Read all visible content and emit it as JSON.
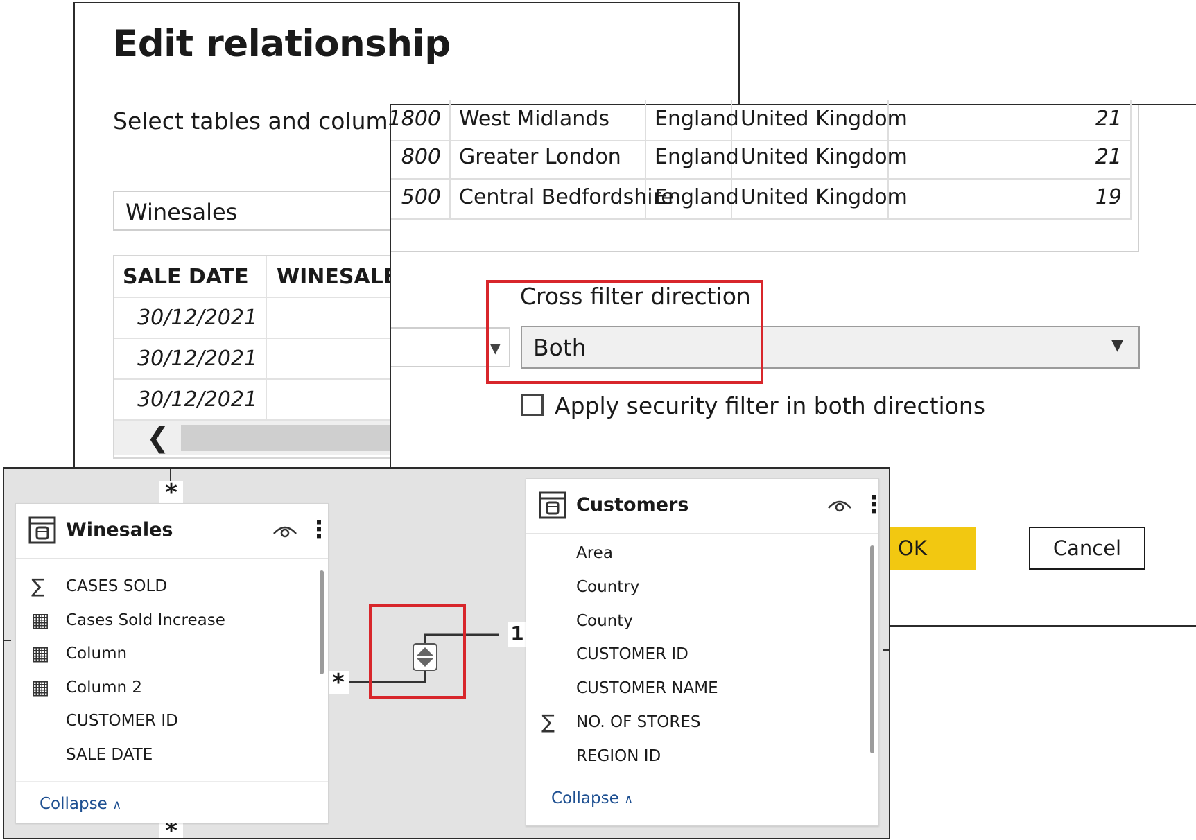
{
  "back_dialog": {
    "title": "Edit relationship",
    "subtitle": "Select tables and column",
    "table_select": {
      "value": "Winesales"
    },
    "preview": {
      "columns": [
        "SALE DATE",
        "WINESALES"
      ],
      "rows": [
        [
          "30/12/2021"
        ],
        [
          "30/12/2021"
        ],
        [
          "30/12/2021"
        ]
      ]
    }
  },
  "front_dialog": {
    "preview_rows": [
      [
        "1800",
        "West Midlands",
        "England",
        "United Kingdom",
        "21"
      ],
      [
        "800",
        "Greater London",
        "England",
        "United Kingdom",
        "21"
      ],
      [
        "500",
        "Central Bedfordshire",
        "England",
        "United Kingdom",
        "19"
      ]
    ],
    "cross_filter": {
      "label": "Cross filter direction",
      "value": "Both"
    },
    "security_filter": {
      "label": "Apply security filter in both directions",
      "checked": false
    },
    "ok_label": "OK",
    "cancel_label": "Cancel"
  },
  "model_view": {
    "winesales": {
      "title": "Winesales",
      "fields": [
        {
          "name": "CASES SOLD",
          "icon": "sigma-icon"
        },
        {
          "name": "Cases Sold Increase",
          "icon": "calculated-column-icon"
        },
        {
          "name": "Column",
          "icon": "calculated-column-icon"
        },
        {
          "name": "Column 2",
          "icon": "calculated-column-icon"
        },
        {
          "name": "CUSTOMER ID",
          "icon": ""
        },
        {
          "name": "SALE DATE",
          "icon": ""
        }
      ],
      "collapse_label": "Collapse"
    },
    "customers": {
      "title": "Customers",
      "fields": [
        {
          "name": "Area",
          "icon": ""
        },
        {
          "name": "Country",
          "icon": ""
        },
        {
          "name": "County",
          "icon": ""
        },
        {
          "name": "CUSTOMER ID",
          "icon": ""
        },
        {
          "name": "CUSTOMER NAME",
          "icon": ""
        },
        {
          "name": "NO. OF STORES",
          "icon": "sigma-icon"
        },
        {
          "name": "REGION ID",
          "icon": ""
        }
      ],
      "collapse_label": "Collapse"
    },
    "relationship": {
      "many_marker": "*",
      "one_marker": "1",
      "direction": "both-directions-icon"
    }
  },
  "colors": {
    "ok_button": "#f2c811",
    "highlight": "#d8262b",
    "link": "#1d4f91",
    "canvas": "#e3e3e3"
  }
}
